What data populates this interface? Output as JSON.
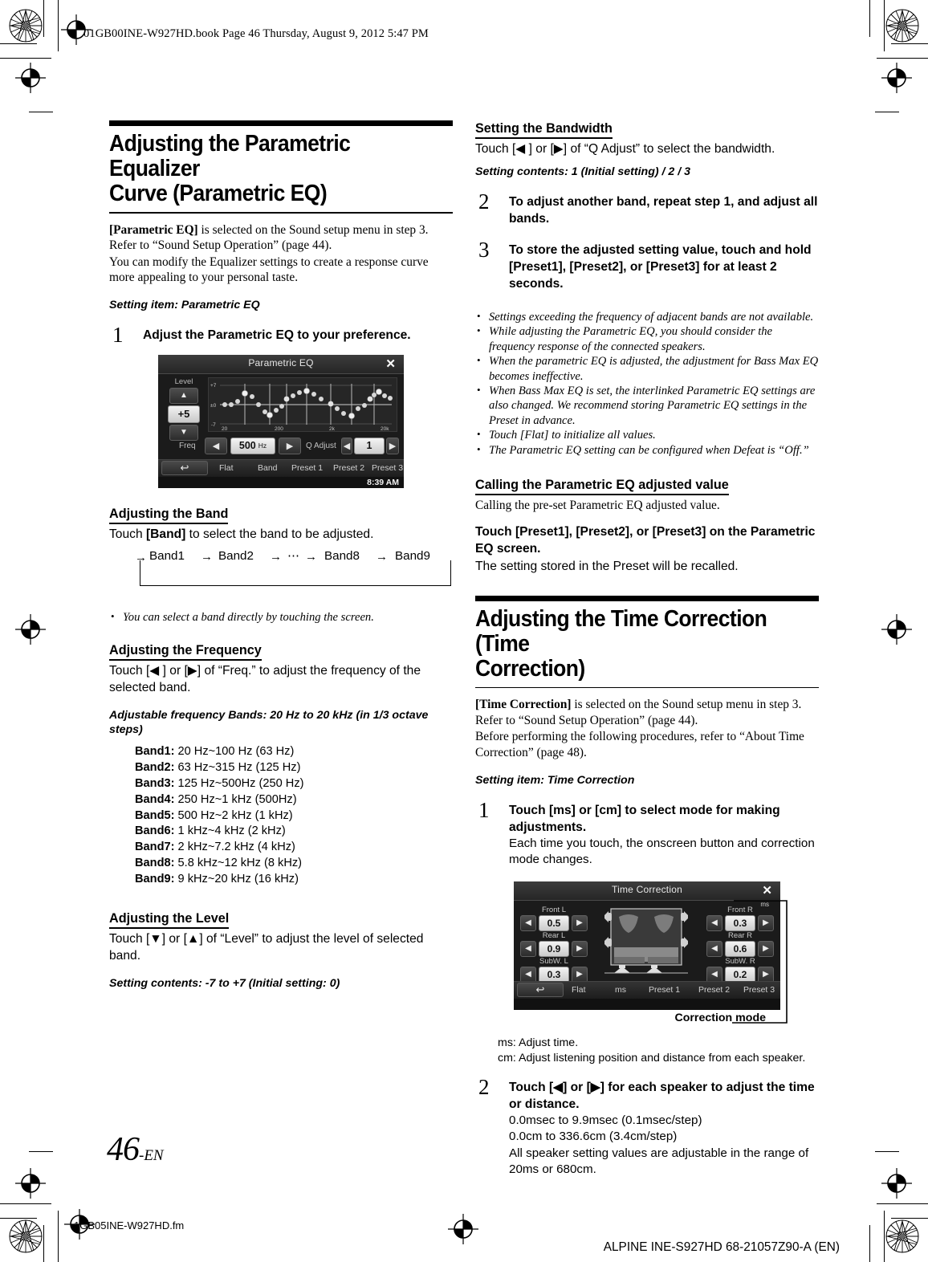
{
  "header": {
    "slug": "01GB00INE-W927HD.book  Page 46  Thursday, August 9, 2012  5:47 PM"
  },
  "footer": {
    "page_number": "46",
    "page_suffix": "-EN",
    "file_name": "1GB05INE-W927HD.fm",
    "model_line": "ALPINE INE-S927HD 68-21057Z90-A (EN)"
  },
  "left_column": {
    "chapter_title": "Adjusting the Parametric Equalizer\nCurve (Parametric EQ)",
    "intro_1_bold": "[Parametric EQ]",
    "intro_1_rest": " is selected on the Sound setup menu in step 3. Refer to “Sound Setup Operation” (page 44).",
    "intro_2": "You can modify the Equalizer settings to create a response curve more appealing to your personal taste.",
    "setting_item": "Setting item: Parametric EQ",
    "step1": {
      "num": "1",
      "title": "Adjust the Parametric EQ to your preference."
    },
    "eq_screen": {
      "title": "Parametric EQ",
      "close": "✕",
      "level_label": "Level",
      "level_up": "▲",
      "level_value": "+5",
      "level_down": "▼",
      "axis_top": "+7",
      "axis_mid": "±0",
      "axis_bottom": "-7",
      "xticks": [
        "20",
        "200",
        "2k",
        "20k"
      ],
      "freq_label": "Freq",
      "freq_prev": "◀",
      "freq_value": "500",
      "freq_unit": "Hz",
      "freq_next": "▶",
      "q_label": "Q Adjust",
      "q_prev": "◀",
      "q_value": "1",
      "q_next": "▶",
      "back": "↩",
      "buttons": [
        "Flat",
        "Band",
        "Preset 1",
        "Preset 2",
        "Preset 3"
      ],
      "clock": "8:39 AM"
    },
    "band_section": {
      "heading": "Adjusting the Band",
      "text_pre": "Touch ",
      "text_bold": "[Band]",
      "text_post": " to select the band to be adjusted.",
      "cycle": [
        "Band1",
        "Band2",
        "⋯",
        "Band8",
        "Band9"
      ],
      "note": "You can select a band directly by touching the screen."
    },
    "freq_section": {
      "heading": "Adjusting the Frequency",
      "text": "Touch [◀ ] or [▶] of “Freq.” to adjust the frequency of the selected band.",
      "adjustable_label": "Adjustable frequency Bands: 20 Hz to 20 kHz (in 1/3 octave steps)",
      "bands": [
        {
          "name": "Band1:",
          "range": " 20 Hz~100 Hz (63 Hz)"
        },
        {
          "name": "Band2:",
          "range": " 63 Hz~315 Hz (125 Hz)"
        },
        {
          "name": "Band3:",
          "range": " 125 Hz~500Hz (250 Hz)"
        },
        {
          "name": "Band4:",
          "range": " 250 Hz~1 kHz (500Hz)"
        },
        {
          "name": "Band5:",
          "range": " 500 Hz~2 kHz (1 kHz)"
        },
        {
          "name": "Band6:",
          "range": " 1 kHz~4 kHz (2 kHz)"
        },
        {
          "name": "Band7:",
          "range": " 2 kHz~7.2 kHz (4 kHz)"
        },
        {
          "name": "Band8:",
          "range": " 5.8 kHz~12 kHz (8 kHz)"
        },
        {
          "name": "Band9:",
          "range": " 9 kHz~20 kHz (16 kHz)"
        }
      ]
    },
    "level_section": {
      "heading": "Adjusting the Level",
      "text": "Touch [▼] or [▲] of “Level” to adjust the level of selected band.",
      "contents": "Setting contents: -7 to +7 (Initial setting: 0)"
    }
  },
  "right_column": {
    "bandwidth_section": {
      "heading": "Setting the Bandwidth",
      "text": "Touch [◀ ] or [▶] of “Q Adjust” to select the bandwidth.",
      "contents": "Setting contents: 1 (Initial setting) / 2 / 3"
    },
    "step2": {
      "num": "2",
      "title": "To adjust another band, repeat step 1, and adjust all bands."
    },
    "step3": {
      "num": "3",
      "title_1": "To store the adjusted setting value, touch and hold ",
      "title_preset1": "[Preset1]",
      "title_sep1": ", ",
      "title_preset2": "[Preset2]",
      "title_sep2": ", or ",
      "title_preset3": "[Preset3]",
      "title_2": " for at least 2 seconds."
    },
    "notes": [
      "Settings exceeding the frequency of adjacent bands are not available.",
      "While adjusting the Parametric EQ, you should consider the frequency response of the connected speakers.",
      "When the parametric EQ is adjusted, the adjustment for Bass Max EQ becomes ineffective.",
      "When Bass Max EQ is set, the interlinked Parametric EQ settings are also changed. We recommend storing Parametric EQ settings in the Preset in advance.",
      "Touch [Flat] to initialize all values.",
      "The Parametric EQ setting can be configured when Defeat is “Off.”"
    ],
    "calling_section": {
      "heading": "Calling the Parametric EQ adjusted value",
      "text": "Calling the pre-set Parametric EQ adjusted value.",
      "touch_line": "Touch [Preset1], [Preset2], or [Preset3] on the Parametric EQ screen.",
      "after": "The setting stored in the Preset will be recalled."
    },
    "chapter_title": "Adjusting the Time Correction (Time\nCorrection)",
    "tc_intro_1_bold": "[Time Correction]",
    "tc_intro_1_rest": " is selected on the Sound setup menu in step 3. Refer to “Sound Setup Operation” (page 44).",
    "tc_intro_2": "Before performing the following procedures, refer to “About Time Correction” (page 48).",
    "tc_setting_item": "Setting item: Time Correction",
    "tc_step1": {
      "num": "1",
      "title": "Touch [ms] or [cm] to select mode for making adjustments.",
      "body": "Each time you touch, the onscreen button and correction mode changes."
    },
    "tc_screen": {
      "title": "Time Correction",
      "close": "✕",
      "mode_flag": "ms",
      "speakers": [
        {
          "label": "Front L",
          "value": "0.5"
        },
        {
          "label": "Rear L",
          "value": "0.9"
        },
        {
          "label": "SubW. L",
          "value": "0.3"
        },
        {
          "label": "Front R",
          "value": "0.3"
        },
        {
          "label": "Rear R",
          "value": "0.6"
        },
        {
          "label": "SubW. R",
          "value": "0.2"
        }
      ],
      "prev": "◀",
      "next": "▶",
      "back": "↩",
      "buttons": [
        "Flat",
        "ms",
        "Preset 1",
        "Preset 2",
        "Preset 3"
      ]
    },
    "callout": "Correction mode",
    "mode_lines": [
      "ms: Adjust time.",
      "cm: Adjust listening position and distance from each speaker."
    ],
    "tc_step2": {
      "num": "2",
      "title": "Touch [◀] or  [▶] for each speaker to adjust the time or distance.",
      "body_lines": [
        "0.0msec to 9.9msec (0.1msec/step)",
        "0.0cm to 336.6cm (3.4cm/step)",
        "All speaker setting values are adjustable in the range of 20ms or 680cm."
      ]
    }
  }
}
